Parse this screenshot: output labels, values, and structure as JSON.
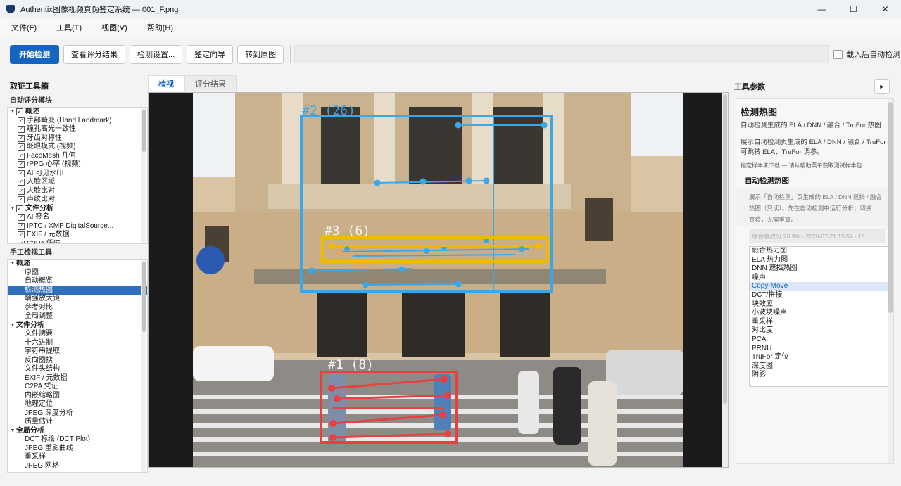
{
  "window": {
    "title": "Authentix图像视频真伪鉴定系统 — 001_F.png",
    "minimize": "—",
    "maximize": "☐",
    "close": "✕"
  },
  "menu": [
    "文件(F)",
    "工具(T)",
    "视图(V)",
    "帮助(H)"
  ],
  "toolbar": {
    "start": "开始检测",
    "scores": "查看评分结果",
    "settings": "检测设置...",
    "guide": "鉴定向导",
    "original": "转到原图",
    "auto_detect": "载入后自动检测",
    "auto_detect_checked": false
  },
  "left": {
    "title": "取证工具箱",
    "auto_label": "自动评分模块",
    "auto_tree": [
      {
        "label": "概述",
        "group": true,
        "checked": true
      },
      {
        "label": "手部畸变 (Hand Landmark)",
        "checked": true
      },
      {
        "label": "瞳孔高光一致性",
        "checked": true
      },
      {
        "label": "牙齿对称性",
        "checked": true
      },
      {
        "label": "眨眼模式 (视频)",
        "checked": true
      },
      {
        "label": "FaceMesh 几何",
        "checked": true
      },
      {
        "label": "rPPG 心率 (视频)",
        "checked": true
      },
      {
        "label": "AI 可见水印",
        "checked": true
      },
      {
        "label": "人脸区域",
        "checked": true
      },
      {
        "label": "人脸比对",
        "checked": true
      },
      {
        "label": "声纹比对",
        "checked": true
      },
      {
        "label": "文件分析",
        "group": true,
        "checked": true
      },
      {
        "label": "AI 签名",
        "checked": true
      },
      {
        "label": "IPTC / XMP DigitalSource...",
        "checked": true
      },
      {
        "label": "EXIF / 元数据",
        "checked": true
      },
      {
        "label": "C2PA 凭证",
        "checked": true
      }
    ],
    "manual_label": "手工检视工具",
    "manual_tree": [
      {
        "label": "概述",
        "group": true
      },
      {
        "label": "原图"
      },
      {
        "label": "自动概览"
      },
      {
        "label": "检测热图",
        "selected": true
      },
      {
        "label": "增强放大镜"
      },
      {
        "label": "参考对比"
      },
      {
        "label": "全局调整"
      },
      {
        "label": "文件分析",
        "group": true
      },
      {
        "label": "文件摘要"
      },
      {
        "label": "十六进制"
      },
      {
        "label": "字符串提取"
      },
      {
        "label": "反向图搜"
      },
      {
        "label": "文件头结构"
      },
      {
        "label": "EXIF / 元数据"
      },
      {
        "label": "C2PA 凭证"
      },
      {
        "label": "内嵌缩略图"
      },
      {
        "label": "地理定位"
      },
      {
        "label": "JPEG 深度分析"
      },
      {
        "label": "质量估计"
      },
      {
        "label": "全局分析",
        "group": true
      },
      {
        "label": "DCT 标绘 (DCT Plot)"
      },
      {
        "label": "JPEG 重影曲线"
      },
      {
        "label": "重采样"
      },
      {
        "label": "JPEG 网格"
      }
    ]
  },
  "tabs": [
    "检视",
    "评分结果"
  ],
  "viewer": {
    "boxes": [
      {
        "label": "#2 (26)",
        "color": "#3aa8e8"
      },
      {
        "label": "#3 (6)",
        "color": "#f5b800"
      },
      {
        "label": "#1 (8)",
        "color": "#e84040"
      }
    ]
  },
  "right": {
    "header": "工具参数",
    "play": "►",
    "title": "检测热图",
    "line1": "自动检测生成的 ELA / DNN / 融合 / TruFor 热图",
    "line2": "展示自动检测页生成的 ELA / DNN / 融合 / TruFor",
    "line3": "可跳转 ELA、TruFor 调参。",
    "hint": "指定样本未下载 — 请从帮助菜单获取测试样本包",
    "group": "自动检测热图",
    "desc1": "展示「自动检测」页生成的 ELA / DNN 遮挡 / 融合",
    "desc2": "热图（只读）。先在自动检测中运行分析；切换",
    "desc3": "查看，无需重算。",
    "meta": "综合篡改分 26.9% · 2026-07-21 15:54 · 15",
    "list": [
      "融合热力图",
      "ELA 热力图",
      "DNN 遮挡热图",
      "噪声",
      "Copy-Move",
      "DCT/拼接",
      "块效应",
      "小波块噪声",
      "重采样",
      "对比度",
      "PCA",
      "PRNU",
      "TruFor 定位",
      "深度图",
      "阴影"
    ],
    "list_selected": "Copy-Move"
  }
}
